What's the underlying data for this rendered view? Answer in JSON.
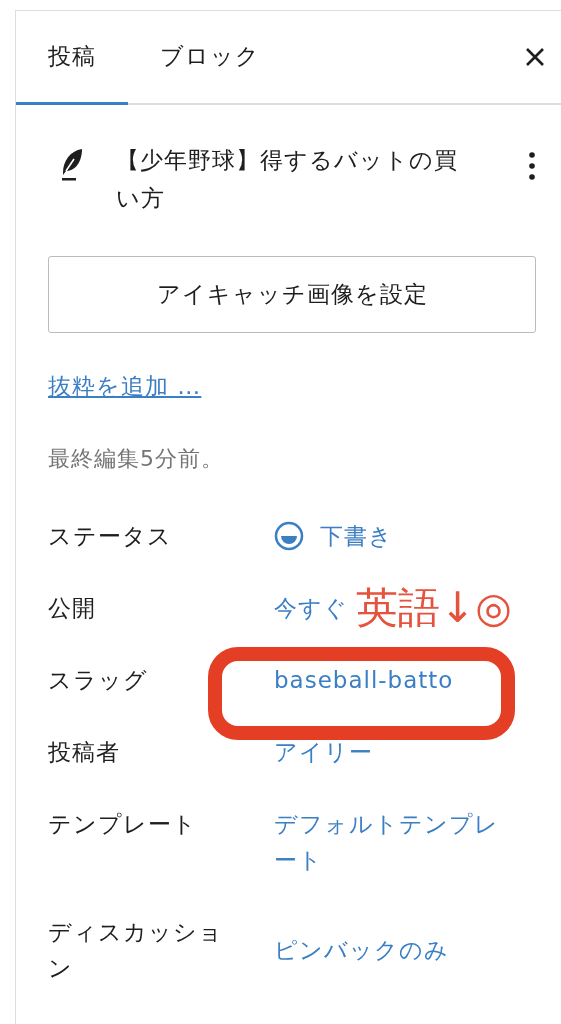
{
  "tabs": [
    {
      "label": "投稿",
      "selected": true
    },
    {
      "label": "ブロック",
      "selected": false
    }
  ],
  "post": {
    "title": "【少年野球】得するバットの買い方"
  },
  "featured_image_button": "アイキャッチ画像を設定",
  "excerpt_link": "抜粋を追加 …",
  "last_edited": "最終編集5分前。",
  "fields": [
    {
      "kind": "status",
      "label": "ステータス",
      "value": "下書き"
    },
    {
      "kind": "link",
      "label": "公開",
      "value": "今すぐ"
    },
    {
      "kind": "link",
      "label": "スラッグ",
      "value": "baseball-batto"
    },
    {
      "kind": "link",
      "label": "投稿者",
      "value": "アイリー"
    },
    {
      "kind": "link",
      "label": "テンプレート",
      "value": "デフォルトテンプレート"
    },
    {
      "kind": "link",
      "label": "ディスカッション",
      "value": "ピンバックのみ"
    }
  ],
  "annotation": {
    "text": "英語↓◎"
  }
}
